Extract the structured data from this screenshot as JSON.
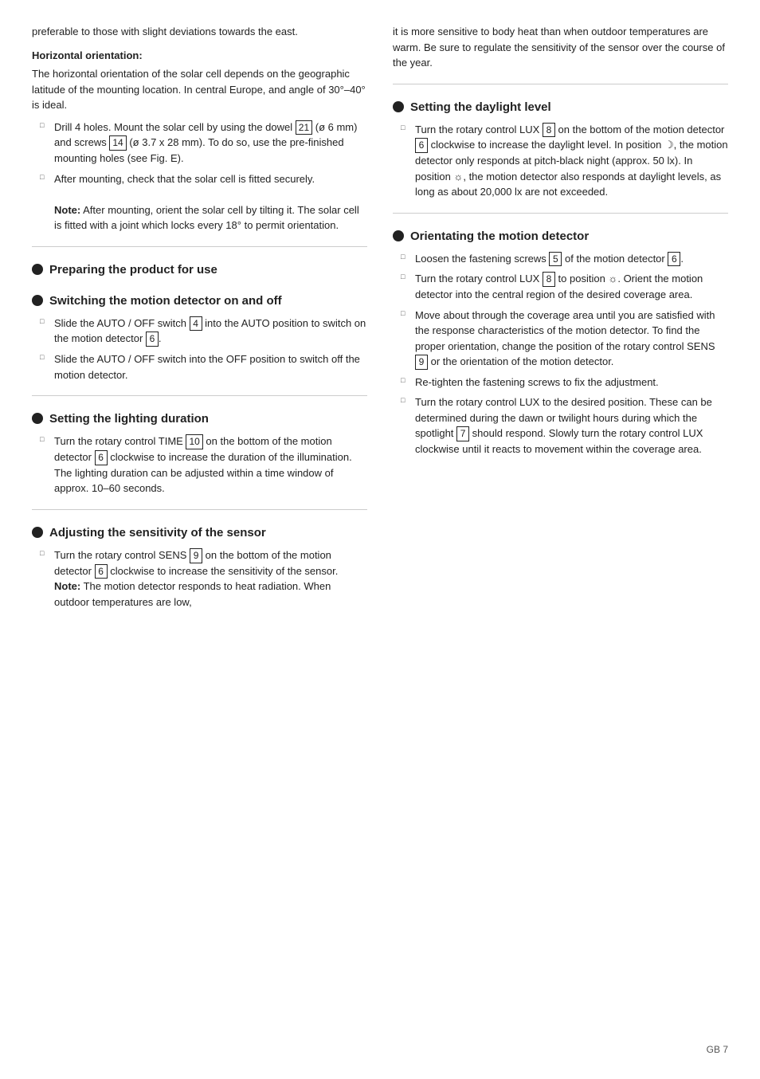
{
  "left_col": {
    "intro_text": "preferable to those with slight deviations towards the east.",
    "horizontal_heading": "Horizontal orientation:",
    "horizontal_body": "The horizontal orientation of the solar cell depends on the geographic latitude of the mounting location. In central Europe, and angle of 30°–40° is ideal.",
    "drill_item": {
      "text_before_num1": "Drill 4 holes. Mount the solar cell by using the dowel",
      "num1": "21",
      "text_after_num1": "(ø 6 mm) and screws",
      "num2": "14",
      "text_after_num2": "(ø 3.7 x 28 mm). To do so, use the pre-finished mounting holes (see Fig. E)."
    },
    "after_mounting": "After mounting, check that the solar cell is fitted securely.",
    "note_label": "Note:",
    "note_text": "After mounting, orient the solar cell by tilting it. The solar cell is fitted with a joint which locks every 18° to permit orientation.",
    "preparing_heading": "Preparing the product for use",
    "switching_heading": "Switching the motion detector on and off",
    "slide_auto_item": {
      "text_before": "Slide the AUTO / OFF switch",
      "num": "4",
      "text_after_before": "into the AUTO position to switch on the motion detector",
      "num2": "6",
      "text_after": "."
    },
    "slide_off_item": "Slide the AUTO / OFF switch into the OFF position to switch off the motion detector.",
    "lighting_duration_heading": "Setting the lighting duration",
    "turn_time_item": {
      "text_before": "Turn the rotary control TIME",
      "num": "10",
      "text_mid": "on the bottom of the motion detector",
      "num2": "6",
      "text_after": "clockwise to increase the duration of the illumination. The lighting duration can be adjusted within a time window of approx. 10–60 seconds."
    },
    "sensitivity_heading": "Adjusting the sensitivity of the sensor",
    "turn_sens_item": {
      "text_before": "Turn the rotary control SENS",
      "num": "9",
      "text_mid": "on the bottom of the motion detector",
      "num2": "6",
      "text_after": "clockwise to increase the sensitivity of the sensor."
    },
    "note2_label": "Note:",
    "note2_text": "The motion detector responds to heat radiation. When outdoor temperatures are low,"
  },
  "right_col": {
    "right_intro": "it is more sensitive to body heat than when outdoor temperatures are warm. Be sure to regulate the sensitivity of the sensor over the course of the year.",
    "daylight_heading": "Setting the daylight level",
    "turn_lux_item": {
      "text_before": "Turn the rotary control LUX",
      "num": "8",
      "text_mid": "on the bottom of the motion detector",
      "num2": "6",
      "text_mid2": "clockwise to increase the daylight level. In position",
      "moon": "☽",
      "text_mid3": ", the motion detector only responds at pitch-black night (approx. 50 lx). In position",
      "sun": "☼",
      "text_after": ", the motion detector also responds at daylight levels, as long as about 20,000 lx are not exceeded."
    },
    "orientating_heading": "Orientating the motion detector",
    "loosen_item": {
      "text_before": "Loosen the fastening screws",
      "num": "5",
      "text_mid": "of the motion detector",
      "num2": "6",
      "text_after": "."
    },
    "turn_lux2_item": {
      "text_before": "Turn the rotary control LUX",
      "num": "8",
      "text_mid": "to position",
      "sun": "☼",
      "text_after": ". Orient the motion detector into the central region of the desired coverage area."
    },
    "move_item": "Move about through the coverage area until you are satisfied with the response characteristics of the motion detector. To find the proper orientation, change the position of the rotary control SENS",
    "move_num": "9",
    "move_text_after": "or the orientation of the motion detector.",
    "retighten_item": "Re-tighten the fastening screws to fix the adjustment.",
    "turn_lux3_item": {
      "text_before": "Turn the rotary control LUX to the desired position. These can be determined during the dawn or twilight hours during which the spotlight",
      "num": "7",
      "text_after": "should respond. Slowly turn the rotary control LUX clockwise until it reacts to movement within the coverage area."
    }
  },
  "footer": {
    "text": "GB    7"
  }
}
